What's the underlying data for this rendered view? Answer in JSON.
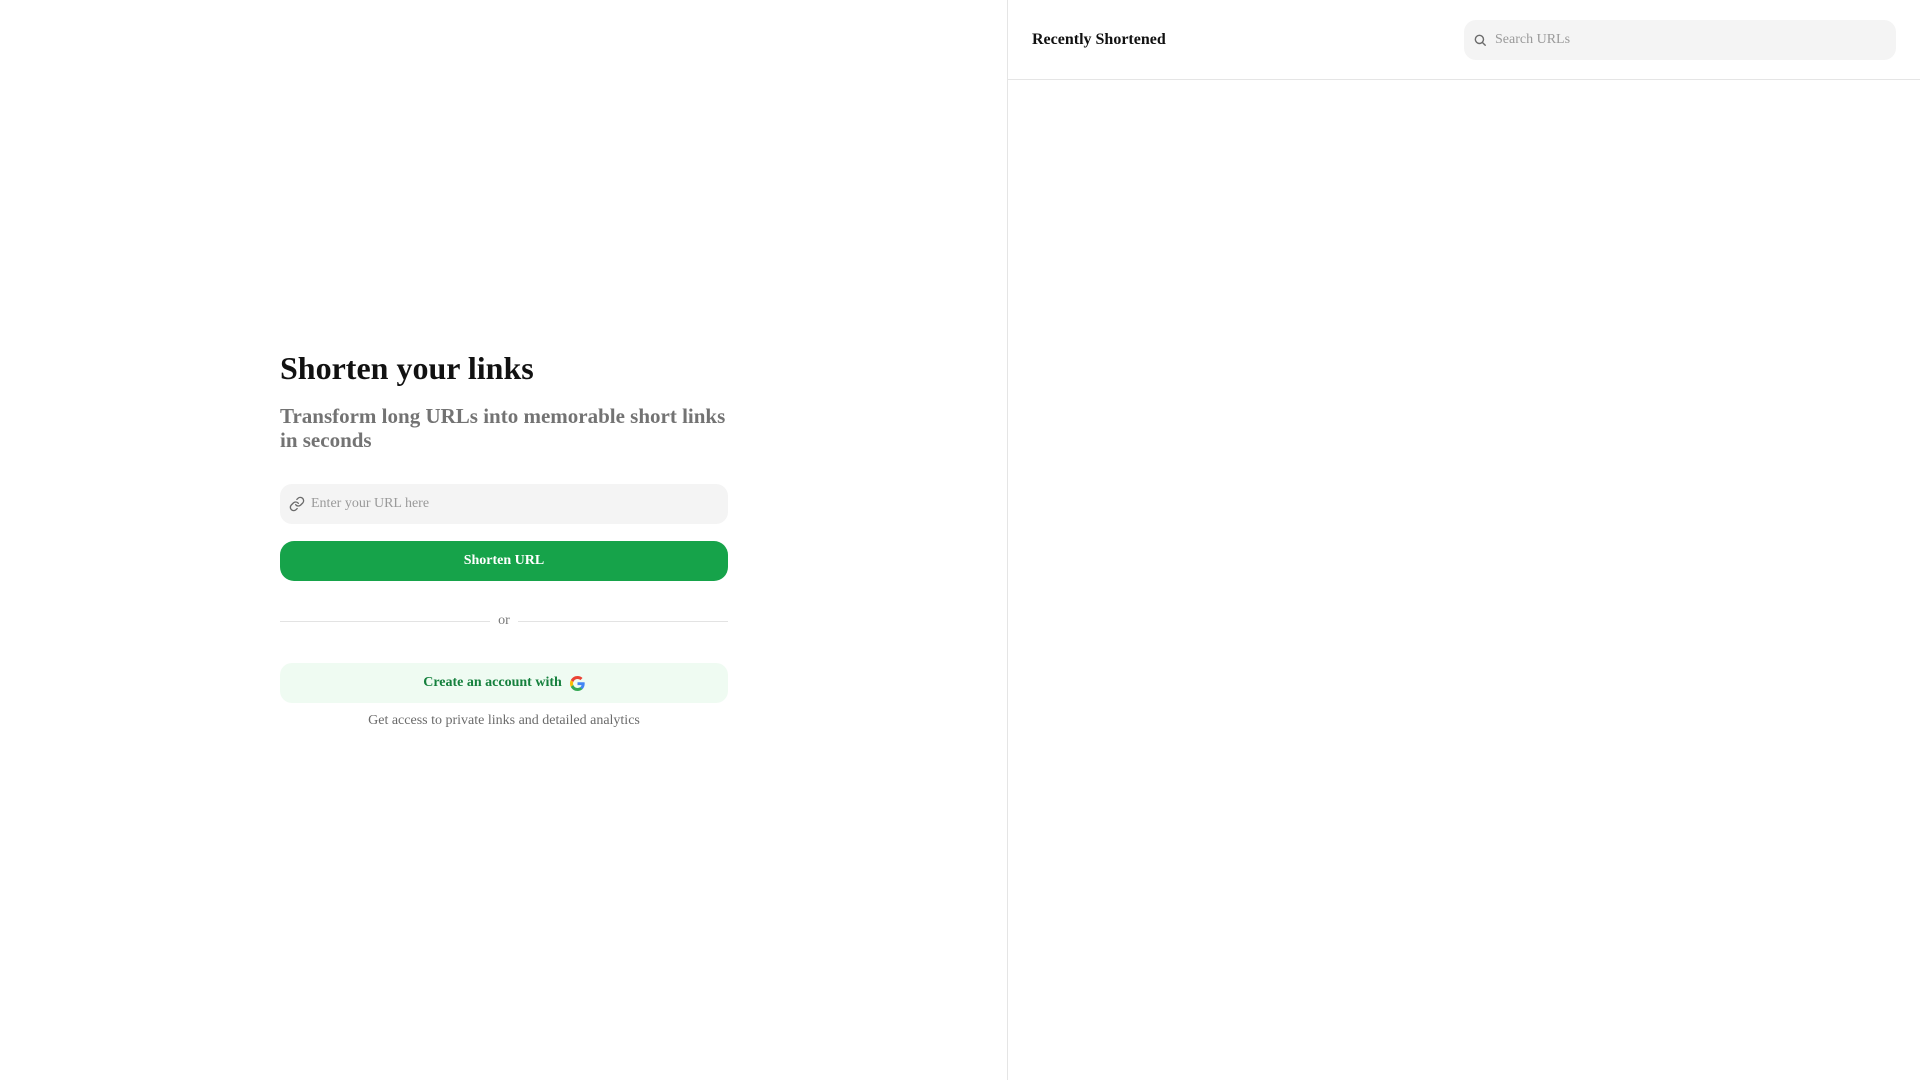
{
  "hero": {
    "title": "Shorten your links",
    "subtitle": "Transform long URLs into memorable short links in seconds"
  },
  "url_form": {
    "input_icon": "link-icon",
    "input_placeholder": "Enter your URL here",
    "input_value": "",
    "submit_label": "Shorten URL"
  },
  "divider": {
    "text": "or"
  },
  "signup": {
    "button_label": "Create an account with",
    "provider_icon": "google-icon",
    "hint": "Get access to private links and detailed analytics"
  },
  "recent": {
    "title": "Recently Shortened",
    "search_icon": "search-icon",
    "search_placeholder": "Search URLs",
    "search_value": "",
    "items": []
  },
  "colors": {
    "primary": "#16a34a",
    "primary_text_on_light": "#15803d",
    "primary_light_bg": "#effbf2",
    "muted_text": "#737373",
    "input_bg": "#f4f4f4",
    "border": "#e5e5e5"
  }
}
